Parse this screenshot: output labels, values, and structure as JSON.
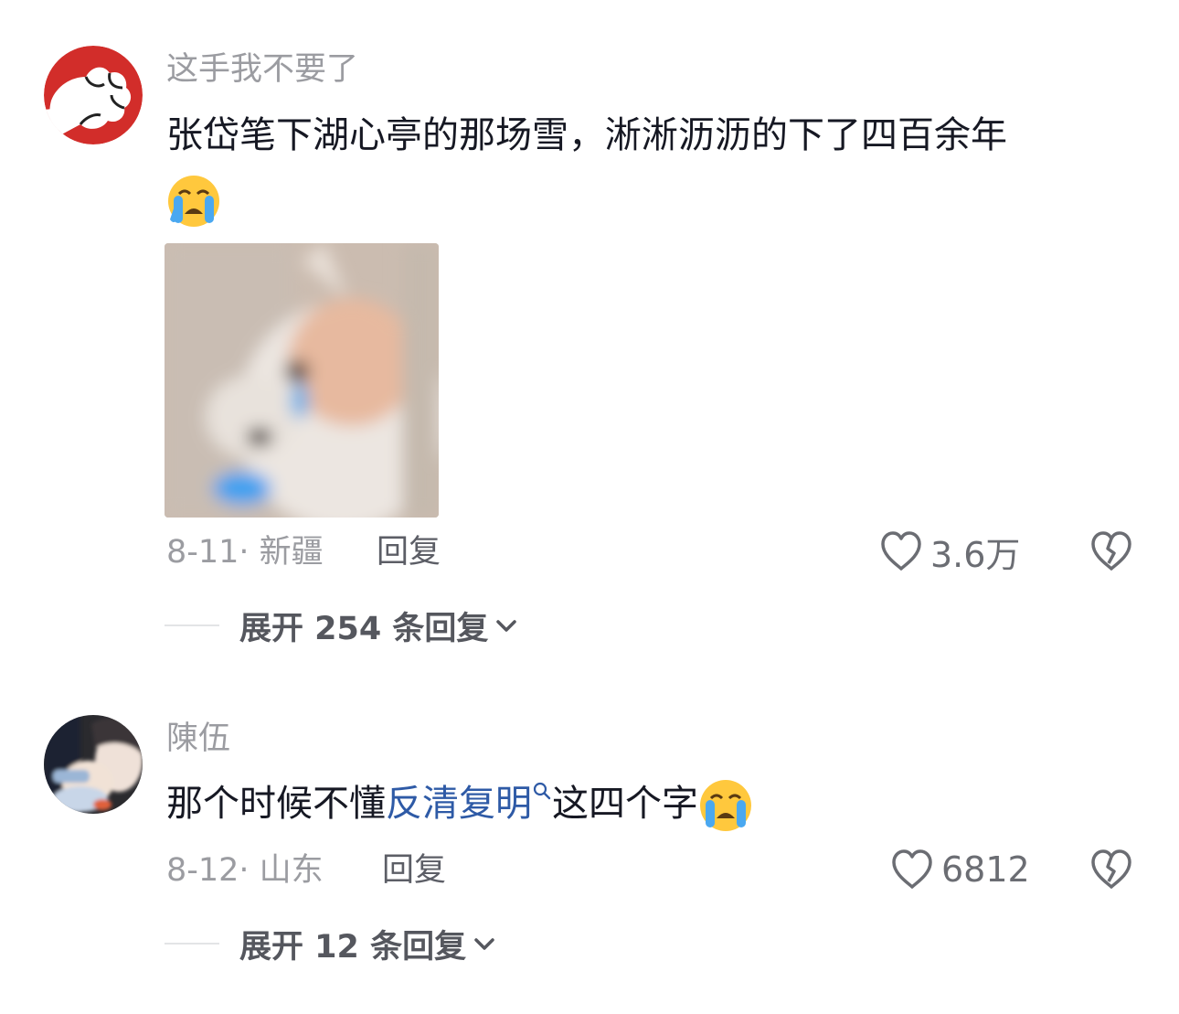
{
  "comments": [
    {
      "username": "这手我不要了",
      "text": "张岱笔下湖心亭的那场雪，淅淅沥沥的下了四百余年",
      "date_location": "8-11· 新疆",
      "reply_label": "回复",
      "like_count": "3.6万",
      "expand_label": "展开 254 条回复",
      "emoji": "loudly-crying-face",
      "image": "blurry-crying-cat-sticker"
    },
    {
      "username": "陳伍",
      "text_before": "那个时候不懂",
      "link_text": "反清复明",
      "text_after": "这四个字",
      "date_location": "8-12· 山东",
      "reply_label": "回复",
      "like_count": "6812",
      "expand_label": "展开 12 条回复",
      "emoji": "loudly-crying-face"
    }
  ],
  "colors": {
    "username": "#9b9ca1",
    "text": "#161823",
    "link": "#2e5aa6",
    "meta": "#9b9ca1",
    "expand_text": "#55575e"
  },
  "icons": {
    "like": "heart-outline-icon",
    "dislike": "broken-heart-icon",
    "expand": "chevron-down-icon",
    "link_search": "search-icon"
  }
}
